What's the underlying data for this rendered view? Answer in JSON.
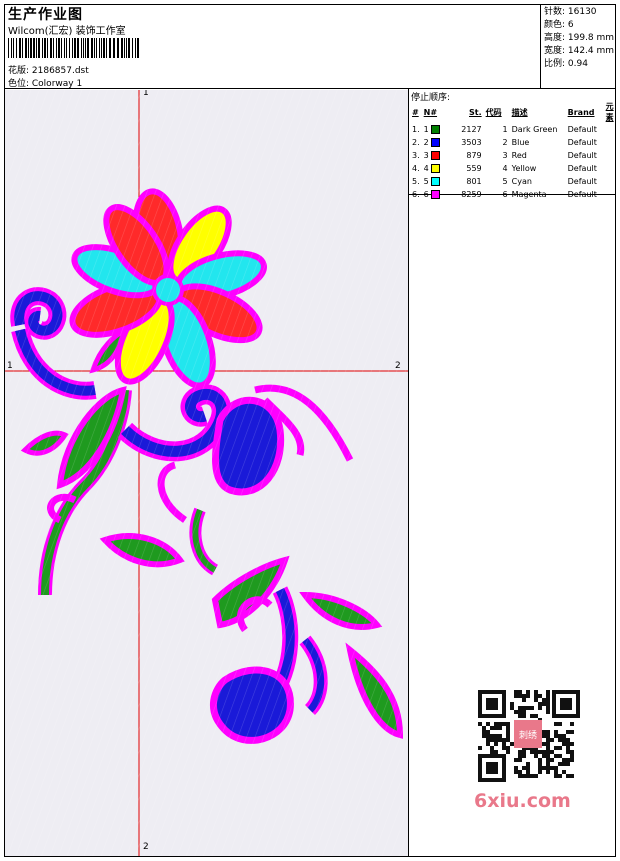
{
  "header": {
    "title": "生产作业图",
    "subtitle": "Wilcom(汇宏) 装饰工作室",
    "pattern": "花版: 2186857.dst",
    "colorway": "色位: Colorway 1"
  },
  "stats": {
    "stitches": "针数: 16130",
    "colors": "颜色: 6",
    "height": "高度: 199.8 mm",
    "width": "宽度: 142.4 mm",
    "scale": "比例: 0.94"
  },
  "sequence": {
    "title": "停止顺序:",
    "headers": [
      "#",
      "N#",
      "St.",
      "代码",
      "描述",
      "Brand",
      "元素"
    ],
    "rows": [
      {
        "idx": "1.",
        "n": "1",
        "color": "#008000",
        "st": "2127",
        "code": "1",
        "desc": "Dark Green",
        "brand": "Default"
      },
      {
        "idx": "2.",
        "n": "2",
        "color": "#0000ff",
        "st": "3503",
        "code": "2",
        "desc": "Blue",
        "brand": "Default"
      },
      {
        "idx": "3.",
        "n": "3",
        "color": "#ff0000",
        "st": "879",
        "code": "3",
        "desc": "Red",
        "brand": "Default"
      },
      {
        "idx": "4.",
        "n": "4",
        "color": "#ffff00",
        "st": "559",
        "code": "4",
        "desc": "Yellow",
        "brand": "Default"
      },
      {
        "idx": "5.",
        "n": "5",
        "color": "#00ffff",
        "st": "801",
        "code": "5",
        "desc": "Cyan",
        "brand": "Default"
      },
      {
        "idx": "6.",
        "n": "6",
        "color": "#ff00ff",
        "st": "8259",
        "code": "6",
        "desc": "Magenta",
        "brand": "Default"
      }
    ]
  },
  "axes": {
    "v_top": "1",
    "v_bottom": "2",
    "h_left": "1",
    "h_right": "2"
  },
  "watermark": "6xiu.com",
  "qr_stamp": "刺绣"
}
